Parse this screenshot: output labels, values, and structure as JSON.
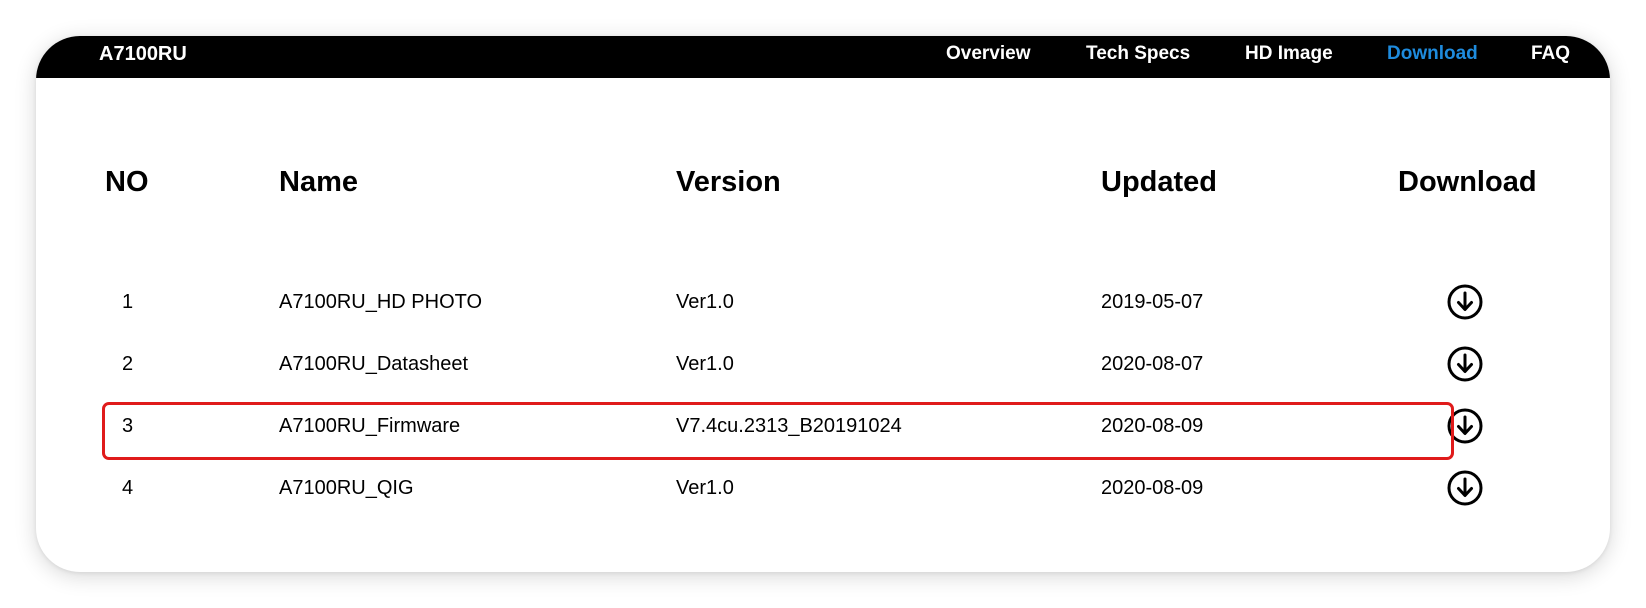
{
  "header": {
    "brand": "A7100RU",
    "nav": [
      {
        "label": "Overview",
        "active": false
      },
      {
        "label": "Tech Specs",
        "active": false
      },
      {
        "label": "HD Image",
        "active": false
      },
      {
        "label": "Download",
        "active": true
      },
      {
        "label": "FAQ",
        "active": false
      }
    ],
    "active_color": "#1e8bdd"
  },
  "table": {
    "headers": [
      "NO",
      "Name",
      "Version",
      "Updated",
      "Download"
    ],
    "rows": [
      {
        "no": "1",
        "name": "A7100RU_HD PHOTO",
        "version": "Ver1.0",
        "updated": "2019-05-07",
        "icon": "download-circle-icon"
      },
      {
        "no": "2",
        "name": "A7100RU_Datasheet",
        "version": "Ver1.0",
        "updated": "2020-08-07",
        "icon": "download-circle-icon"
      },
      {
        "no": "3",
        "name": "A7100RU_Firmware",
        "version": "V7.4cu.2313_B20191024",
        "updated": "2020-08-09",
        "icon": "download-circle-icon",
        "highlighted": true
      },
      {
        "no": "4",
        "name": "A7100RU_QIG",
        "version": "Ver1.0",
        "updated": "2020-08-09",
        "icon": "download-circle-icon"
      }
    ],
    "highlight_color": "#e01b1b"
  }
}
